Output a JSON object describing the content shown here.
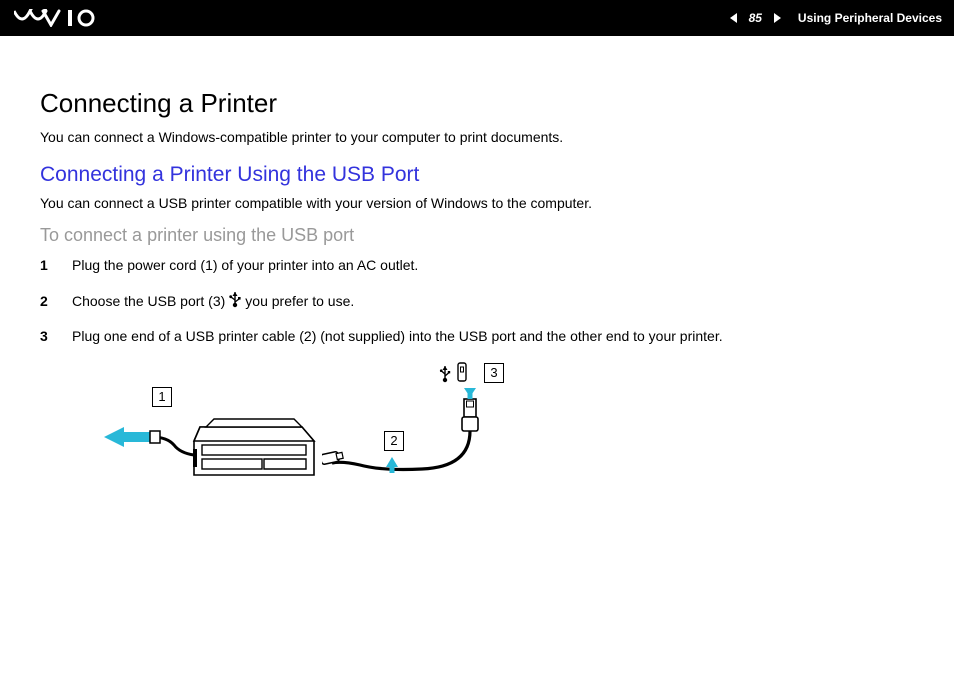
{
  "header": {
    "page_number": "85",
    "section_title": "Using Peripheral Devices"
  },
  "content": {
    "title": "Connecting a Printer",
    "intro": "You can connect a Windows-compatible printer to your computer to print documents.",
    "subtitle": "Connecting a Printer Using the USB Port",
    "sub_intro": "You can connect a USB printer compatible with your version of Windows to the computer.",
    "procedure_title": "To connect a printer using the USB port",
    "steps": [
      {
        "num": "1",
        "text": "Plug the power cord (1) of your printer into an AC outlet."
      },
      {
        "num": "2",
        "text_before": "Choose the USB port (3) ",
        "text_after": " you prefer to use."
      },
      {
        "num": "3",
        "text": "Plug one end of a USB printer cable (2) (not supplied) into the USB port and the other end to your printer."
      }
    ]
  },
  "diagram": {
    "callouts": {
      "c1": "1",
      "c2": "2",
      "c3": "3"
    }
  }
}
